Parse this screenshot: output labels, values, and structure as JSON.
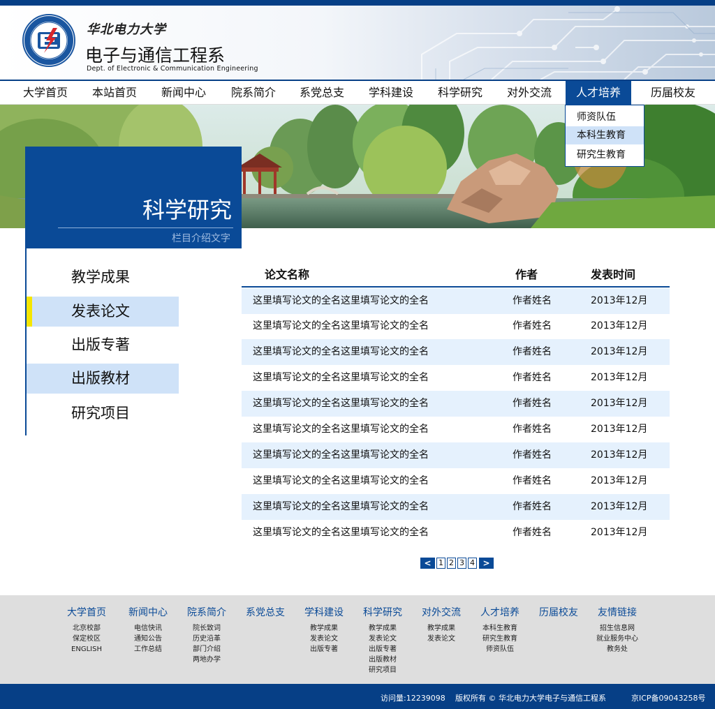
{
  "header": {
    "school_cn": "华北电力大学",
    "dept_cn": "电子与通信工程系",
    "dept_en": "Dept. of Electronic & Communication Engineering",
    "logo_icon": "university-seal-icon"
  },
  "nav": {
    "items": [
      "大学首页",
      "本站首页",
      "新闻中心",
      "院系简介",
      "系党总支",
      "学科建设",
      "科学研究",
      "对外交流",
      "人才培养",
      "历届校友"
    ],
    "active": "人才培养"
  },
  "dropdown": {
    "items": [
      "师资队伍",
      "本科生教育",
      "研究生教育"
    ],
    "active": "本科生教育"
  },
  "section": {
    "title": "科学研究",
    "subtitle": "栏目介绍文字"
  },
  "sidebar": {
    "items": [
      "教学成果",
      "发表论文",
      "出版专著",
      "出版教材",
      "研究项目"
    ],
    "active": "发表论文"
  },
  "table": {
    "headers": [
      "论文名称",
      "作者",
      "发表时间"
    ],
    "rows": [
      [
        "这里填写论文的全名这里填写论文的全名",
        "作者姓名",
        "2013年12月"
      ],
      [
        "这里填写论文的全名这里填写论文的全名",
        "作者姓名",
        "2013年12月"
      ],
      [
        "这里填写论文的全名这里填写论文的全名",
        "作者姓名",
        "2013年12月"
      ],
      [
        "这里填写论文的全名这里填写论文的全名",
        "作者姓名",
        "2013年12月"
      ],
      [
        "这里填写论文的全名这里填写论文的全名",
        "作者姓名",
        "2013年12月"
      ],
      [
        "这里填写论文的全名这里填写论文的全名",
        "作者姓名",
        "2013年12月"
      ],
      [
        "这里填写论文的全名这里填写论文的全名",
        "作者姓名",
        "2013年12月"
      ],
      [
        "这里填写论文的全名这里填写论文的全名",
        "作者姓名",
        "2013年12月"
      ],
      [
        "这里填写论文的全名这里填写论文的全名",
        "作者姓名",
        "2013年12月"
      ],
      [
        "这里填写论文的全名这里填写论文的全名",
        "作者姓名",
        "2013年12月"
      ]
    ]
  },
  "pager": {
    "prev": "<",
    "next": ">",
    "pages": [
      "1",
      "2",
      "3",
      "4"
    ]
  },
  "footer": {
    "columns": [
      {
        "title": "大学首页",
        "links": [
          "北京校部",
          "保定校区",
          "ENGLISH"
        ]
      },
      {
        "title": "新闻中心",
        "links": [
          "电信快讯",
          "通知公告",
          "工作总结"
        ]
      },
      {
        "title": "院系简介",
        "links": [
          "院长致词",
          "历史沿革",
          "部门介绍",
          "两地办学"
        ]
      },
      {
        "title": "系党总支",
        "links": []
      },
      {
        "title": "学科建设",
        "links": [
          "教学成果",
          "发表论文",
          "出版专著"
        ]
      },
      {
        "title": "科学研究",
        "links": [
          "教学成果",
          "发表论文",
          "出版专著",
          "出版教材",
          "研究项目"
        ]
      },
      {
        "title": "对外交流",
        "links": [
          "教学成果",
          "发表论文"
        ]
      },
      {
        "title": "人才培养",
        "links": [
          "本科生教育",
          "研究生教育",
          "师资队伍"
        ]
      },
      {
        "title": "历届校友",
        "links": []
      },
      {
        "title": "友情链接",
        "links": [
          "招生信息网",
          "就业服务中心",
          "教务处"
        ]
      }
    ],
    "visits": "访问量:12239098",
    "copyright": "版权所有 © 华北电力大学电子与通信工程系",
    "icp": "京ICP备09043258号"
  },
  "colors": {
    "brand_blue": "#0a4a97",
    "highlight_blue": "#cfe2f8",
    "row_shade": "#e5f1fd",
    "active_marker": "#f5e600"
  }
}
